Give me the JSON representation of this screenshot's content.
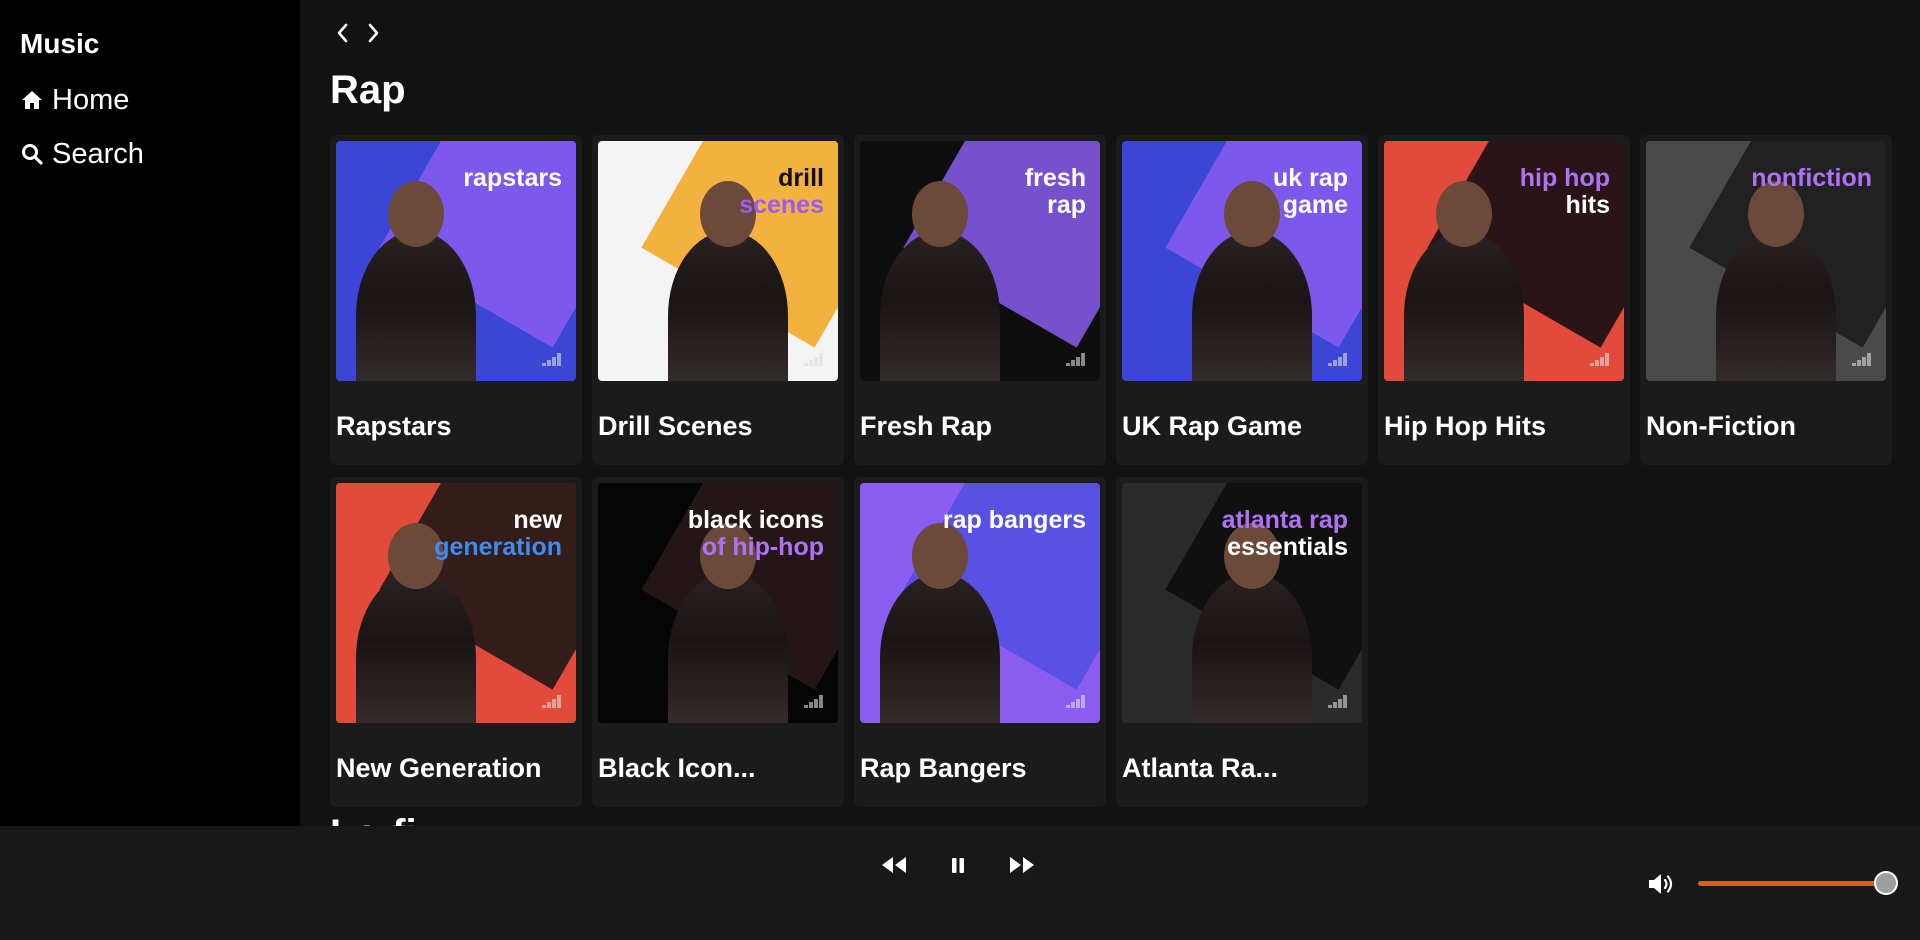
{
  "app": {
    "title": "Music"
  },
  "nav": {
    "items": [
      {
        "label": "Home",
        "icon": "home-icon"
      },
      {
        "label": "Search",
        "icon": "search-icon"
      }
    ]
  },
  "topnav": {
    "back_icon": "chevron-left-icon",
    "forward_icon": "chevron-right-icon"
  },
  "section": {
    "title": "Rap",
    "next_title": "Lo-fi"
  },
  "playlists": [
    {
      "title": "Rapstars",
      "cover_text_a": "rapstars",
      "cover_text_b": "",
      "bg": "#3b45d6",
      "accent": "#8a5cf0",
      "text_color": "#ffffff",
      "accent_text_color": "#ffffff"
    },
    {
      "title": "Drill Scenes",
      "cover_text_a": "drill",
      "cover_text_b": "scenes",
      "bg": "#f4f4f4",
      "accent": "#f2a51c",
      "text_color": "#111111",
      "accent_text_color": "#9b5cf0"
    },
    {
      "title": "Fresh Rap",
      "cover_text_a": "fresh",
      "cover_text_b": "rap",
      "bg": "#0e0e0e",
      "accent": "#8a5cf0",
      "text_color": "#ffffff",
      "accent_text_color": "#ffffff"
    },
    {
      "title": "UK Rap Game",
      "cover_text_a": "uk rap",
      "cover_text_b": "game",
      "bg": "#3b45d6",
      "accent": "#8a5cf0",
      "text_color": "#ffffff",
      "accent_text_color": "#ffffff"
    },
    {
      "title": "Hip Hop Hits",
      "cover_text_a": "hip hop",
      "cover_text_b": "hits",
      "bg": "#e24b3b",
      "accent": "#0b0b12",
      "text_color": "#b072f5",
      "accent_text_color": "#ffffff"
    },
    {
      "title": "Non-Fiction",
      "cover_text_a": "nonfiction",
      "cover_text_b": "",
      "bg": "#4a4a4a",
      "accent": "#1a1a1a",
      "text_color": "#b072f5",
      "accent_text_color": "#ffffff"
    },
    {
      "title": "New Generation",
      "cover_text_a": "new",
      "cover_text_b": "generation",
      "bg": "#e24b3b",
      "accent": "#141414",
      "text_color": "#ffffff",
      "accent_text_color": "#3d8cf0"
    },
    {
      "title": "Black Icon...",
      "cover_text_a": "black icons",
      "cover_text_b": "of hip-hop",
      "bg": "#050505",
      "accent": "#2a1a1a",
      "text_color": "#ffffff",
      "accent_text_color": "#b072f5"
    },
    {
      "title": "Rap Bangers",
      "cover_text_a": "rap bangers",
      "cover_text_b": "",
      "bg": "#8a5cf0",
      "accent": "#4f4fe0",
      "text_color": "#ffffff",
      "accent_text_color": "#ffffff"
    },
    {
      "title": "Atlanta Ra...",
      "cover_text_a": "atlanta rap",
      "cover_text_b": "essentials",
      "bg": "#2a2a2a",
      "accent": "#0c0c0c",
      "text_color": "#b072f5",
      "accent_text_color": "#ffffff"
    }
  ],
  "player": {
    "prev_icon": "rewind-icon",
    "pause_icon": "pause-icon",
    "next_icon": "fast-forward-icon",
    "volume_icon": "volume-icon",
    "volume_level": 1.0,
    "accent": "#e8571c"
  }
}
